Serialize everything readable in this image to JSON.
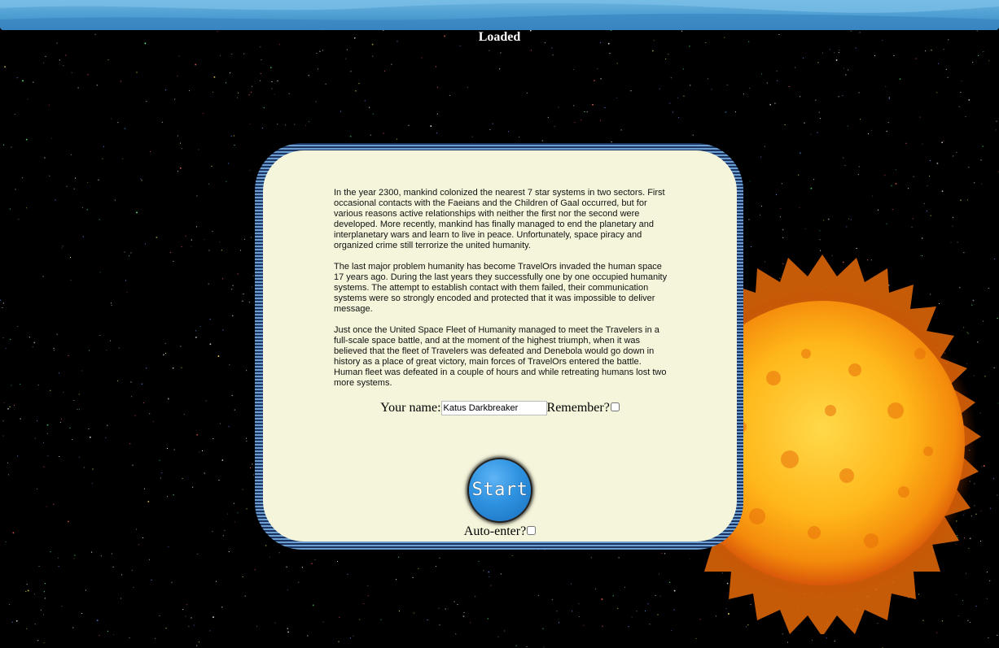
{
  "header": {
    "status": "Loaded"
  },
  "story": {
    "paragraphs": [
      "In the year 2300, mankind colonized the nearest 7 star systems in two sectors. First occasional contacts with the Faeians and the Children of Gaal occurred, but for various reasons active relationships with neither the first nor the second were developed. More recently, mankind has finally managed to end the planetary and interplanetary wars and learn to live in peace. Unfortunately, space piracy and organized crime still terrorize the united humanity.",
      "The last major problem humanity has become TravelOrs invaded the human space 17 years ago. During the last years they successfully one by one occupied humanity systems. The attempt to establish contact with them failed, their communication systems were so strongly encoded and protected that it was impossible to deliver message.",
      "Just once the United Space Fleet of Humanity managed to meet the Travelers in a full-scale space battle, and at the moment of the highest triumph, when it was believed that the fleet of Travelers was defeated and Denebola would go down in history as a place of great victory, main forces of TravelOrs entered the battle. Human fleet was defeated in a couple of hours and while retreating humans lost two more systems."
    ]
  },
  "login": {
    "name_label": "Your name:",
    "name_value": "Katus Darkbreaker",
    "remember_label": "Remember?",
    "remember_checked": false,
    "start_label": "Start",
    "auto_enter_label": "Auto-enter?",
    "auto_enter_checked": false
  },
  "colors": {
    "panel_background": "#f5f5db",
    "frame_dark": "#1b3560",
    "frame_light": "#6d9ed2",
    "start_button": "#2e92e0",
    "top_bar": "#4e9fd3"
  },
  "icons": {
    "sun": "sun-icon",
    "stars": "starfield"
  }
}
